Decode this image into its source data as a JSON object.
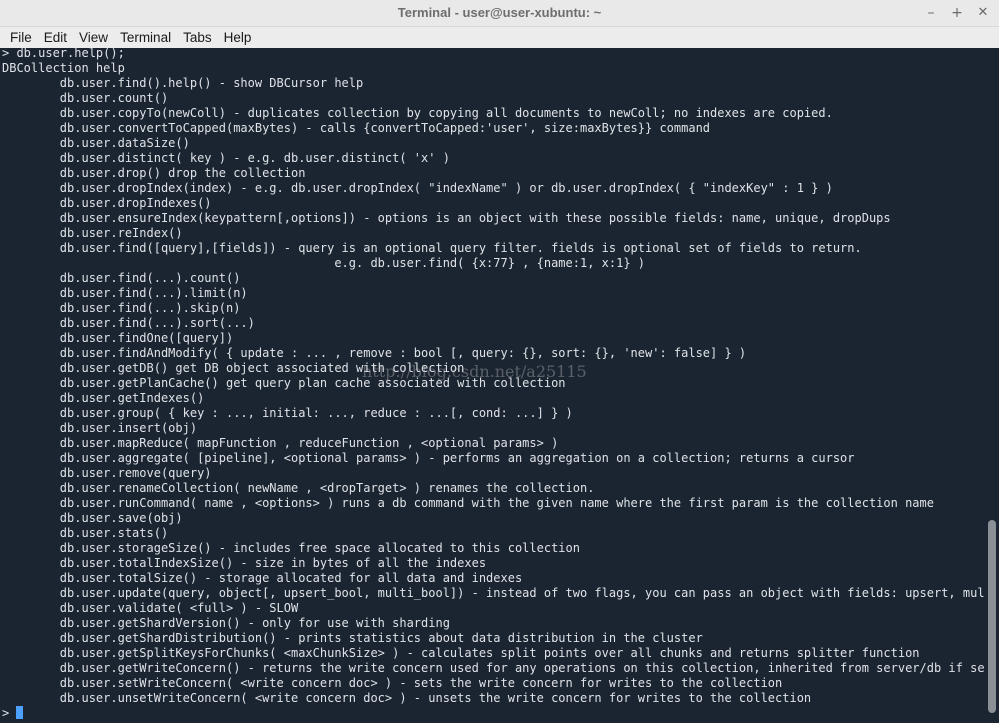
{
  "window": {
    "title": "Terminal - user@user-xubuntu: ~"
  },
  "menubar": {
    "items": [
      "File",
      "Edit",
      "View",
      "Terminal",
      "Tabs",
      "Help"
    ]
  },
  "terminal": {
    "lines": [
      "> db.user.help();",
      "DBCollection help",
      "        db.user.find().help() - show DBCursor help",
      "        db.user.count()",
      "        db.user.copyTo(newColl) - duplicates collection by copying all documents to newColl; no indexes are copied.",
      "        db.user.convertToCapped(maxBytes) - calls {convertToCapped:'user', size:maxBytes}} command",
      "        db.user.dataSize()",
      "        db.user.distinct( key ) - e.g. db.user.distinct( 'x' )",
      "        db.user.drop() drop the collection",
      "        db.user.dropIndex(index) - e.g. db.user.dropIndex( \"indexName\" ) or db.user.dropIndex( { \"indexKey\" : 1 } )",
      "        db.user.dropIndexes()",
      "        db.user.ensureIndex(keypattern[,options]) - options is an object with these possible fields: name, unique, dropDups",
      "        db.user.reIndex()",
      "        db.user.find([query],[fields]) - query is an optional query filter. fields is optional set of fields to return.",
      "                                              e.g. db.user.find( {x:77} , {name:1, x:1} )",
      "        db.user.find(...).count()",
      "        db.user.find(...).limit(n)",
      "        db.user.find(...).skip(n)",
      "        db.user.find(...).sort(...)",
      "        db.user.findOne([query])",
      "        db.user.findAndModify( { update : ... , remove : bool [, query: {}, sort: {}, 'new': false] } )",
      "        db.user.getDB() get DB object associated with collection",
      "        db.user.getPlanCache() get query plan cache associated with collection",
      "        db.user.getIndexes()",
      "        db.user.group( { key : ..., initial: ..., reduce : ...[, cond: ...] } )",
      "        db.user.insert(obj)",
      "        db.user.mapReduce( mapFunction , reduceFunction , <optional params> )",
      "        db.user.aggregate( [pipeline], <optional params> ) - performs an aggregation on a collection; returns a cursor",
      "        db.user.remove(query)",
      "        db.user.renameCollection( newName , <dropTarget> ) renames the collection.",
      "        db.user.runCommand( name , <options> ) runs a db command with the given name where the first param is the collection name",
      "        db.user.save(obj)",
      "        db.user.stats()",
      "        db.user.storageSize() - includes free space allocated to this collection",
      "        db.user.totalIndexSize() - size in bytes of all the indexes",
      "        db.user.totalSize() - storage allocated for all data and indexes",
      "        db.user.update(query, object[, upsert_bool, multi_bool]) - instead of two flags, you can pass an object with fields: upsert, multi",
      "        db.user.validate( <full> ) - SLOW",
      "        db.user.getShardVersion() - only for use with sharding",
      "        db.user.getShardDistribution() - prints statistics about data distribution in the cluster",
      "        db.user.getSplitKeysForChunks( <maxChunkSize> ) - calculates split points over all chunks and returns splitter function",
      "        db.user.getWriteConcern() - returns the write concern used for any operations on this collection, inherited from server/db if set",
      "        db.user.setWriteConcern( <write concern doc> ) - sets the write concern for writes to the collection",
      "        db.user.unsetWriteConcern( <write concern doc> ) - unsets the write concern for writes to the collection"
    ],
    "prompt": "> ",
    "cursor_color": "#4ea0ff"
  },
  "watermark": "http://blog.csdn.net/a25115",
  "colors": {
    "background": "#1b2431",
    "foreground": "#dfe3e8"
  }
}
